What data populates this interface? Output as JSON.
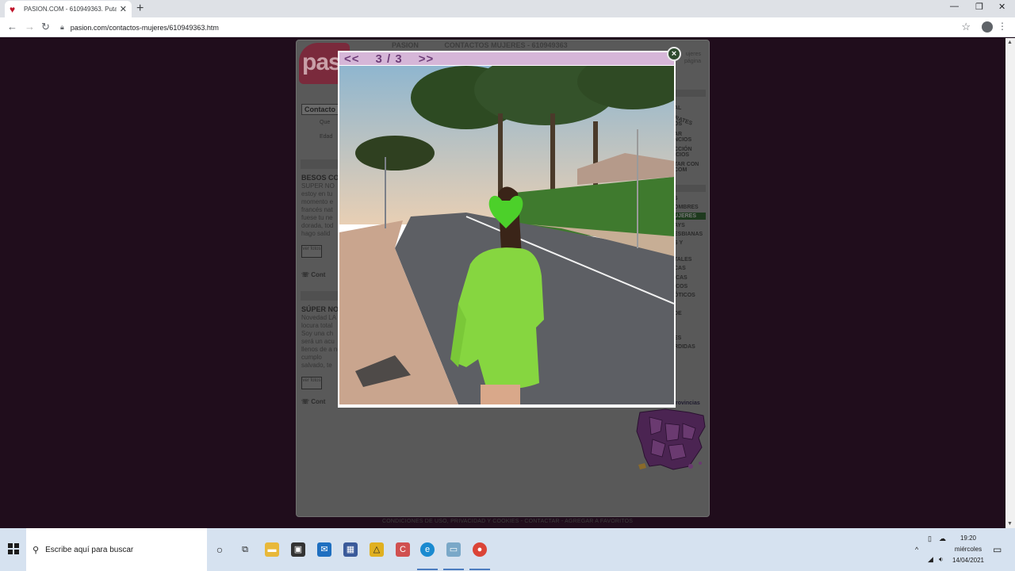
{
  "browser": {
    "tab_title": "PASION.COM - 610949363. Puta",
    "url": "pasion.com/contactos-mujeres/610949363.htm",
    "new_tab": "+",
    "tab_close": "✕"
  },
  "site": {
    "logo_text": "pas",
    "header_brand": "PASION",
    "header_section": "CONTACTOS MUJERES - 610949363",
    "header_right_1": "ujeres",
    "header_right_2": "página",
    "filter_title": "Contacto",
    "filter_que": "Que",
    "filter_edad": "Edad",
    "ads": [
      {
        "title": "BESOS CO",
        "text": "SUPER NO estoy en tu momento e francés nat fuese tu ne dorada, tod hago salid",
        "photos_label": "ver fotos",
        "contact": "Cont"
      },
      {
        "title": "SÚPER NO",
        "text": "Novedad LA locura total Soy una ch será un acu llenos de a no cumplo salvado, te",
        "photos_label": "ver fotos",
        "contact": "Cont"
      }
    ],
    "sidebar": [
      "AL",
      "RATES",
      "OS",
      "AR",
      "NCIOS",
      "CCIÓN",
      "ICIOS",
      "TAR CON",
      "COM",
      "S",
      "OMBRES",
      "UJERES",
      "AYS",
      "ESBIANAS",
      "S Y",
      "TALES",
      "CAS",
      "ICAS",
      "ICOS",
      "ÓTICOS",
      "DE",
      "ES",
      "RDIDAS"
    ],
    "provincias_label": "rovincias",
    "footer": "CONDICIONES DE USO, PRIVACIDAD Y COOKIES - CONTACTAR - AGREGAR A FAVORITOS"
  },
  "lightbox": {
    "prev": "<<",
    "counter": "3 / 3",
    "next": ">>",
    "close": "×"
  },
  "taskbar": {
    "search_placeholder": "Escribe aquí para buscar",
    "time": "19:20",
    "day": "miércoles",
    "date": "14/04/2021"
  },
  "colors": {
    "nav_bar": "#d6b6d8",
    "nav_text": "#6e3d78",
    "page_bg": "#200d1c",
    "taskbar_bg": "#d6e2f0"
  }
}
